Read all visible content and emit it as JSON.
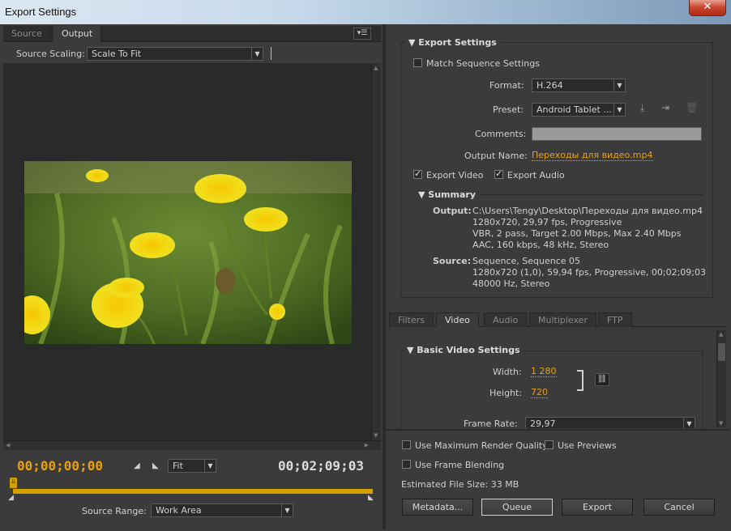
{
  "window": {
    "title": "Export Settings",
    "close_glyph": "✕"
  },
  "left": {
    "tabs": [
      "Source",
      "Output"
    ],
    "panel_menu_glyph": "▾☰",
    "source_scaling_label": "Source Scaling:",
    "source_scaling_value": "Scale To Fit",
    "current_time": "00;00;00;00",
    "fit_value": "Fit",
    "end_time": "00;02;09;03",
    "source_range_label": "Source Range:",
    "source_range_value": "Work Area"
  },
  "export_settings": {
    "header": "Export Settings",
    "match_sequence": "Match Sequence Settings",
    "format_label": "Format:",
    "format_value": "H.264",
    "preset_label": "Preset:",
    "preset_value": "Android Tablet ...",
    "comments_label": "Comments:",
    "comments_value": "",
    "output_name_label": "Output Name:",
    "output_name_value": "Переходы для видео.mp4",
    "export_video": "Export Video",
    "export_audio": "Export Audio"
  },
  "summary": {
    "header": "Summary",
    "output_label": "Output:",
    "output_lines": [
      "C:\\Users\\Tengy\\Desktop\\Переходы для видео.mp4",
      "1280x720, 29,97 fps, Progressive",
      "VBR, 2 pass, Target 2.00 Mbps, Max 2.40 Mbps",
      "AAC, 160 kbps, 48 kHz, Stereo"
    ],
    "source_label": "Source:",
    "source_lines": [
      "Sequence, Sequence 05",
      "1280x720 (1,0), 59,94 fps, Progressive, 00;02;09;03",
      "48000 Hz, Stereo"
    ]
  },
  "settings_tabs": [
    "Filters",
    "Video",
    "Audio",
    "Multiplexer",
    "FTP"
  ],
  "basic_video": {
    "header": "Basic Video Settings",
    "width_label": "Width:",
    "width_value": "1 280",
    "height_label": "Height:",
    "height_value": "720",
    "frame_rate_label": "Frame Rate:",
    "frame_rate_value": "29,97"
  },
  "options": {
    "max_render_quality": "Use Maximum Render Quality",
    "use_previews": "Use Previews",
    "frame_blending": "Use Frame Blending",
    "estimated_size": "Estimated File Size:  33 MB"
  },
  "buttons": {
    "metadata": "Metadata...",
    "queue": "Queue",
    "export": "Export",
    "cancel": "Cancel"
  }
}
